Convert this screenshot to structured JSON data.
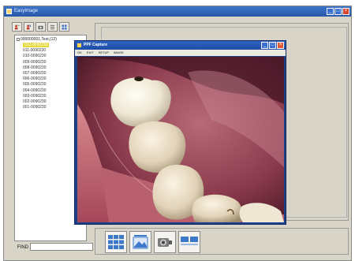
{
  "main_window": {
    "title": "EasyImage",
    "buttons": {
      "minimize": "_",
      "maximize": "□",
      "close": "×"
    }
  },
  "toolbar": {
    "items": [
      {
        "icon": "user-add-icon"
      },
      {
        "icon": "user-edit-icon"
      },
      {
        "icon": "camera-icon"
      },
      {
        "icon": "list-view-icon"
      },
      {
        "icon": "grid-view-icon"
      }
    ]
  },
  "tree": {
    "root_label": "000000001,Test,(12)",
    "items": [
      "012-0090230",
      "011-0090230",
      "010-0090230",
      "009-0090230",
      "008-0090230",
      "007-0090230",
      "006-0090230",
      "005-0090230",
      "004-0090230",
      "003-0090230",
      "002-0090230",
      "001-0090230"
    ],
    "selected_index": 0
  },
  "find": {
    "label": "FIND",
    "value": ""
  },
  "capture_window": {
    "title": "PPF Capture",
    "menu": [
      "OK",
      "EXIT",
      "SETUP",
      "IMAGE"
    ],
    "buttons": {
      "minimize": "_",
      "maximize": "□",
      "close": "×"
    }
  },
  "thumbnail_bar": {
    "buttons": [
      {
        "icon": "grid-layout-icon"
      },
      {
        "icon": "single-image-icon"
      },
      {
        "icon": "intraoral-camera-icon"
      },
      {
        "icon": "dual-layout-icon"
      }
    ]
  },
  "colors": {
    "titlebar": "#2f63c0",
    "panel": "#d8d4c8",
    "selection": "#e6d93c",
    "close": "#d9462f"
  }
}
